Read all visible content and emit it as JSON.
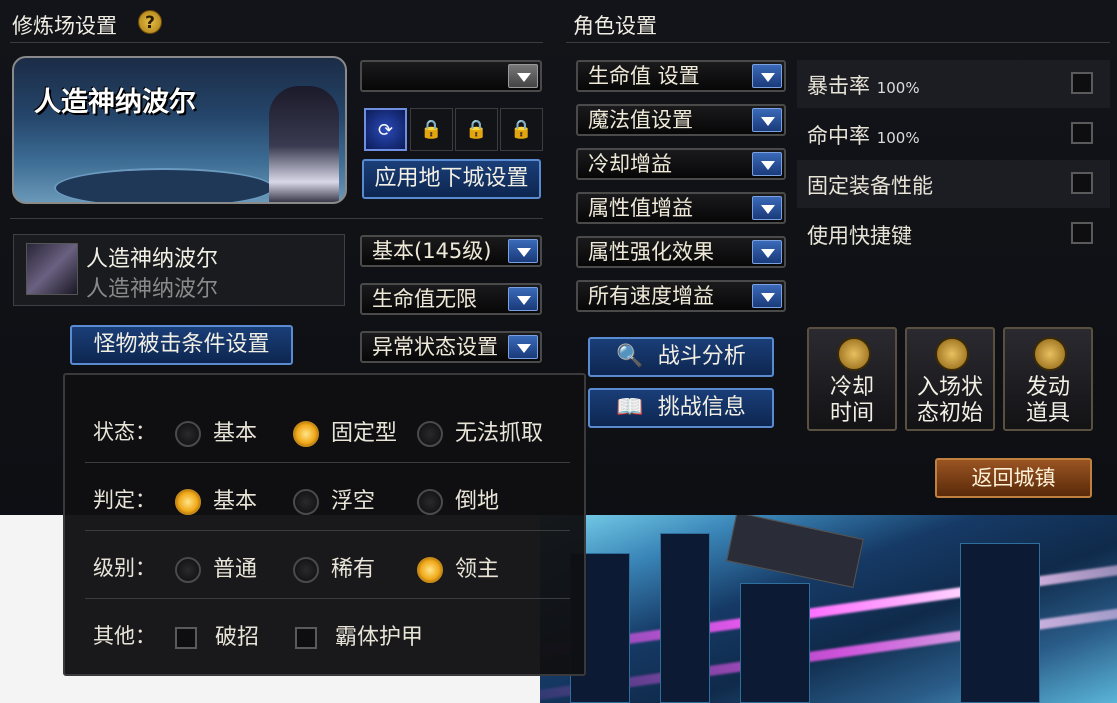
{
  "left": {
    "title": "修炼场设置",
    "help": "?",
    "portrait_name": "人造神纳波尔",
    "dungeon_dropdown": "",
    "apply_button": "应用地下城设置",
    "lock_glyph": "🔒",
    "monster": {
      "name": "人造神纳波尔",
      "subname": "人造神纳波尔"
    },
    "level_dropdown": "基本(145级)",
    "hp_dropdown": "生命值无限",
    "status_dropdown": "异常状态设置",
    "hit_condition_button": "怪物被击条件设置"
  },
  "right": {
    "title": "角色设置",
    "dropdowns": [
      "生命值 设置",
      "魔法值设置",
      "冷却增益",
      "属性值增益",
      "属性强化效果",
      "所有速度增益"
    ],
    "checks": [
      {
        "label": "暴击率",
        "value": "100%"
      },
      {
        "label": "命中率",
        "value": "100%"
      },
      {
        "label": "固定装备性能",
        "value": ""
      },
      {
        "label": "使用快捷键",
        "value": ""
      }
    ],
    "battle_button": "战斗分析",
    "challenge_button": "挑战信息",
    "cooldown_button": [
      "冷却",
      "时间"
    ],
    "init_button": [
      "入场状",
      "态初始"
    ],
    "item_button": [
      "发动",
      "道具"
    ],
    "return_button": "返回城镇"
  },
  "popup": {
    "rows": [
      {
        "label": "状态：",
        "options": [
          {
            "text": "基本",
            "on": false
          },
          {
            "text": "固定型",
            "on": true
          },
          {
            "text": "无法抓取",
            "on": false
          }
        ]
      },
      {
        "label": "判定：",
        "options": [
          {
            "text": "基本",
            "on": true
          },
          {
            "text": "浮空",
            "on": false
          },
          {
            "text": "倒地",
            "on": false
          }
        ]
      },
      {
        "label": "级别：",
        "options": [
          {
            "text": "普通",
            "on": false
          },
          {
            "text": "稀有",
            "on": false
          },
          {
            "text": "领主",
            "on": true
          }
        ]
      }
    ],
    "other_label": "其他：",
    "other_checks": [
      "破招",
      "霸体护甲"
    ]
  },
  "colors": {
    "accent_blue": "#1a3e78",
    "radio_on": "#f0a818",
    "return_btn": "#9a5422"
  }
}
